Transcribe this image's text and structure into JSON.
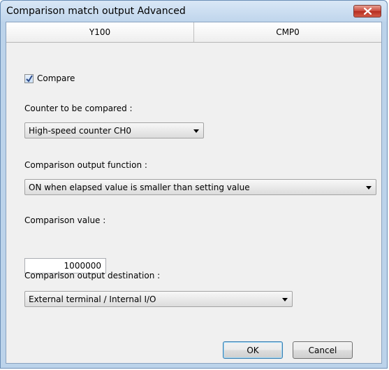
{
  "window": {
    "title": "Comparison match output Advanced"
  },
  "header": {
    "left": "Y100",
    "right": "CMP0"
  },
  "compare": {
    "label": "Compare",
    "checked": true
  },
  "counter": {
    "label": "Counter to be compared :",
    "value": "High-speed counter CH0"
  },
  "function": {
    "label": "Comparison output function :",
    "value": "ON when elapsed value is smaller than setting value"
  },
  "value_field": {
    "label": "Comparison value :",
    "value": "1000000"
  },
  "destination": {
    "label": "Comparison output destination :",
    "value": "External terminal / Internal I/O"
  },
  "buttons": {
    "ok": "OK",
    "cancel": "Cancel"
  },
  "icons": {
    "close": "close-icon",
    "check": "checkmark-icon",
    "dropdown": "chevron-down-icon"
  },
  "colors": {
    "titlebar": "#bfd5ec",
    "close": "#c9473a",
    "client": "#f0f0f0"
  }
}
